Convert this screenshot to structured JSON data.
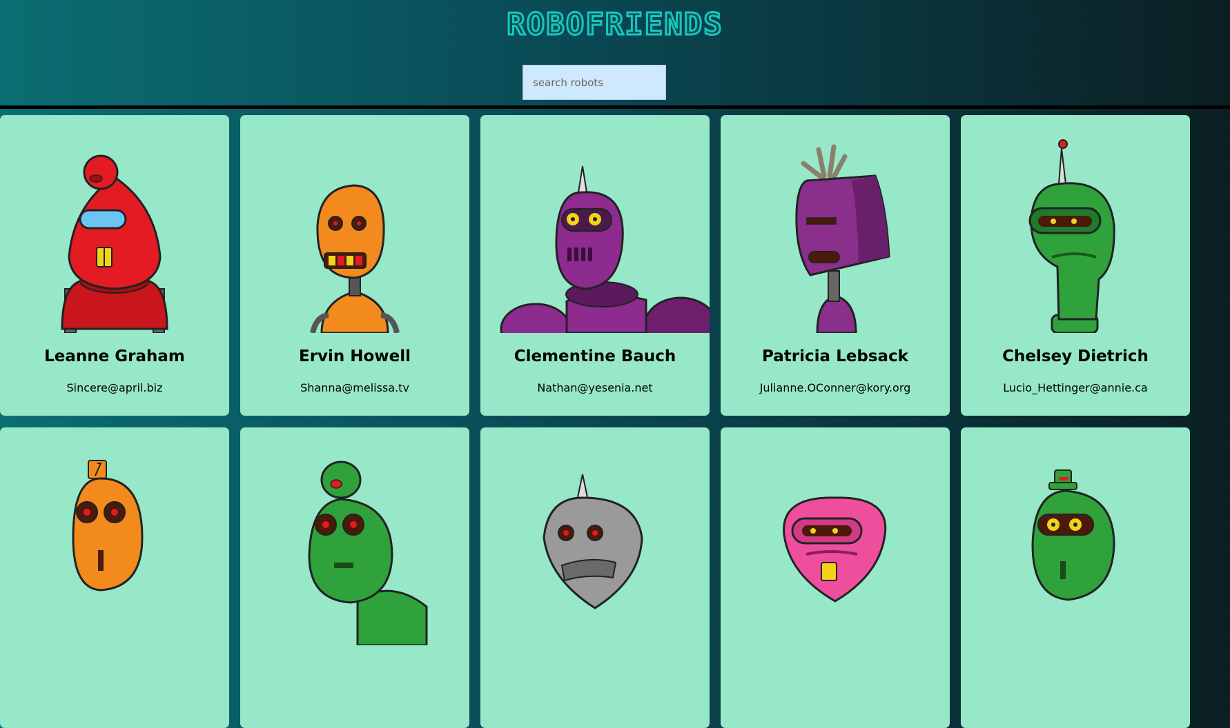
{
  "app": {
    "title": "ROBOFRIENDS"
  },
  "search": {
    "placeholder": "search robots",
    "value": ""
  },
  "robots": [
    {
      "name": "Leanne Graham",
      "email": "Sincere@april.biz",
      "color": "#e31b23"
    },
    {
      "name": "Ervin Howell",
      "email": "Shanna@melissa.tv",
      "color": "#f28a1e"
    },
    {
      "name": "Clementine Bauch",
      "email": "Nathan@yesenia.net",
      "color": "#8e2b8f"
    },
    {
      "name": "Patricia Lebsack",
      "email": "Julianne.OConner@kory.org",
      "color": "#8a2f8c"
    },
    {
      "name": "Chelsey Dietrich",
      "email": "Lucio_Hettinger@annie.ca",
      "color": "#2fa23c"
    },
    {
      "name": "",
      "email": "",
      "color": "#f28a1e"
    },
    {
      "name": "",
      "email": "",
      "color": "#2fa23c"
    },
    {
      "name": "",
      "email": "",
      "color": "#9a9a9a"
    },
    {
      "name": "",
      "email": "",
      "color": "#ee4f9c"
    },
    {
      "name": "",
      "email": "",
      "color": "#2fa23c"
    }
  ]
}
